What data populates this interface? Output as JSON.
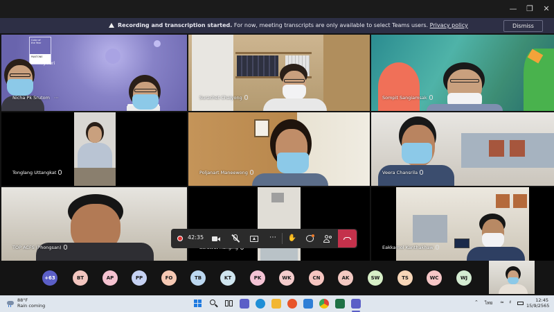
{
  "window": {
    "minimize_icon": "minimize-icon",
    "maximize_icon": "maximize-icon",
    "close_icon": "close-icon"
  },
  "banner": {
    "title": "Recording and transcription started.",
    "message": " For now, meeting transcripts are only available to select Teams users. ",
    "link": "Privacy policy",
    "dismiss_label": "Dismiss"
  },
  "participants": [
    {
      "name": "Nicha Pk Srutom"
    },
    {
      "name": "Surachet Chaiyong"
    },
    {
      "name": "Sompit Sangiamsak"
    },
    {
      "name": "Tonglang Uttangkat"
    },
    {
      "name": "Poljanart Maneewong"
    },
    {
      "name": "Veera Chansrila"
    },
    {
      "name": "TOP ACFS (Phongsan)"
    },
    {
      "name": "Sarawut Hanging"
    },
    {
      "name": "Eakkamol Kanthakhaw"
    }
  ],
  "controls": {
    "timer": "42:35",
    "record_icon": "record-icon",
    "camera_icon": "camera-icon",
    "mic_icon": "mic-muted-icon",
    "share_icon": "share-screen-icon",
    "more_icon": "more-icon",
    "raise_hand_icon": "raise-hand-icon",
    "chat_icon": "chat-icon",
    "people_icon": "people-icon",
    "hangup_icon": "hangup-icon"
  },
  "overflow": {
    "count_label": "+63",
    "avatars": [
      {
        "initials": "BT",
        "color": "#f3c6c0"
      },
      {
        "initials": "AP",
        "color": "#f6c3d1"
      },
      {
        "initials": "PP",
        "color": "#c6d2f3"
      },
      {
        "initials": "FO",
        "color": "#f6c9b4"
      },
      {
        "initials": "TB",
        "color": "#bcd8f0"
      },
      {
        "initials": "KT",
        "color": "#cfe5ef"
      },
      {
        "initials": "PK",
        "color": "#f4c3d4"
      },
      {
        "initials": "WK",
        "color": "#f4cccc"
      },
      {
        "initials": "CN",
        "color": "#f6c5c0"
      },
      {
        "initials": "AK",
        "color": "#f3c9c2"
      },
      {
        "initials": "SW",
        "color": "#d7efc7"
      },
      {
        "initials": "TS",
        "color": "#f7d6b8"
      },
      {
        "initials": "WC",
        "color": "#f6c6c6"
      },
      {
        "initials": "WJ",
        "color": "#d4ecd2"
      }
    ],
    "count_color": "#5b5fc7"
  },
  "tile_labels": {
    "poster_line1": "Color of",
    "poster_line2": "the Year",
    "poster_brand": "PANTONE",
    "poster_name": "ry Peri"
  },
  "taskbar": {
    "temperature": "88°F",
    "weather_text": "Rain coming",
    "language": "ไทย",
    "time": "12:45",
    "date": "15/9/2565"
  },
  "colors": {
    "banner_bg": "#2d2f45",
    "hangup": "#c4314b",
    "accent": "#5b5fc7"
  }
}
